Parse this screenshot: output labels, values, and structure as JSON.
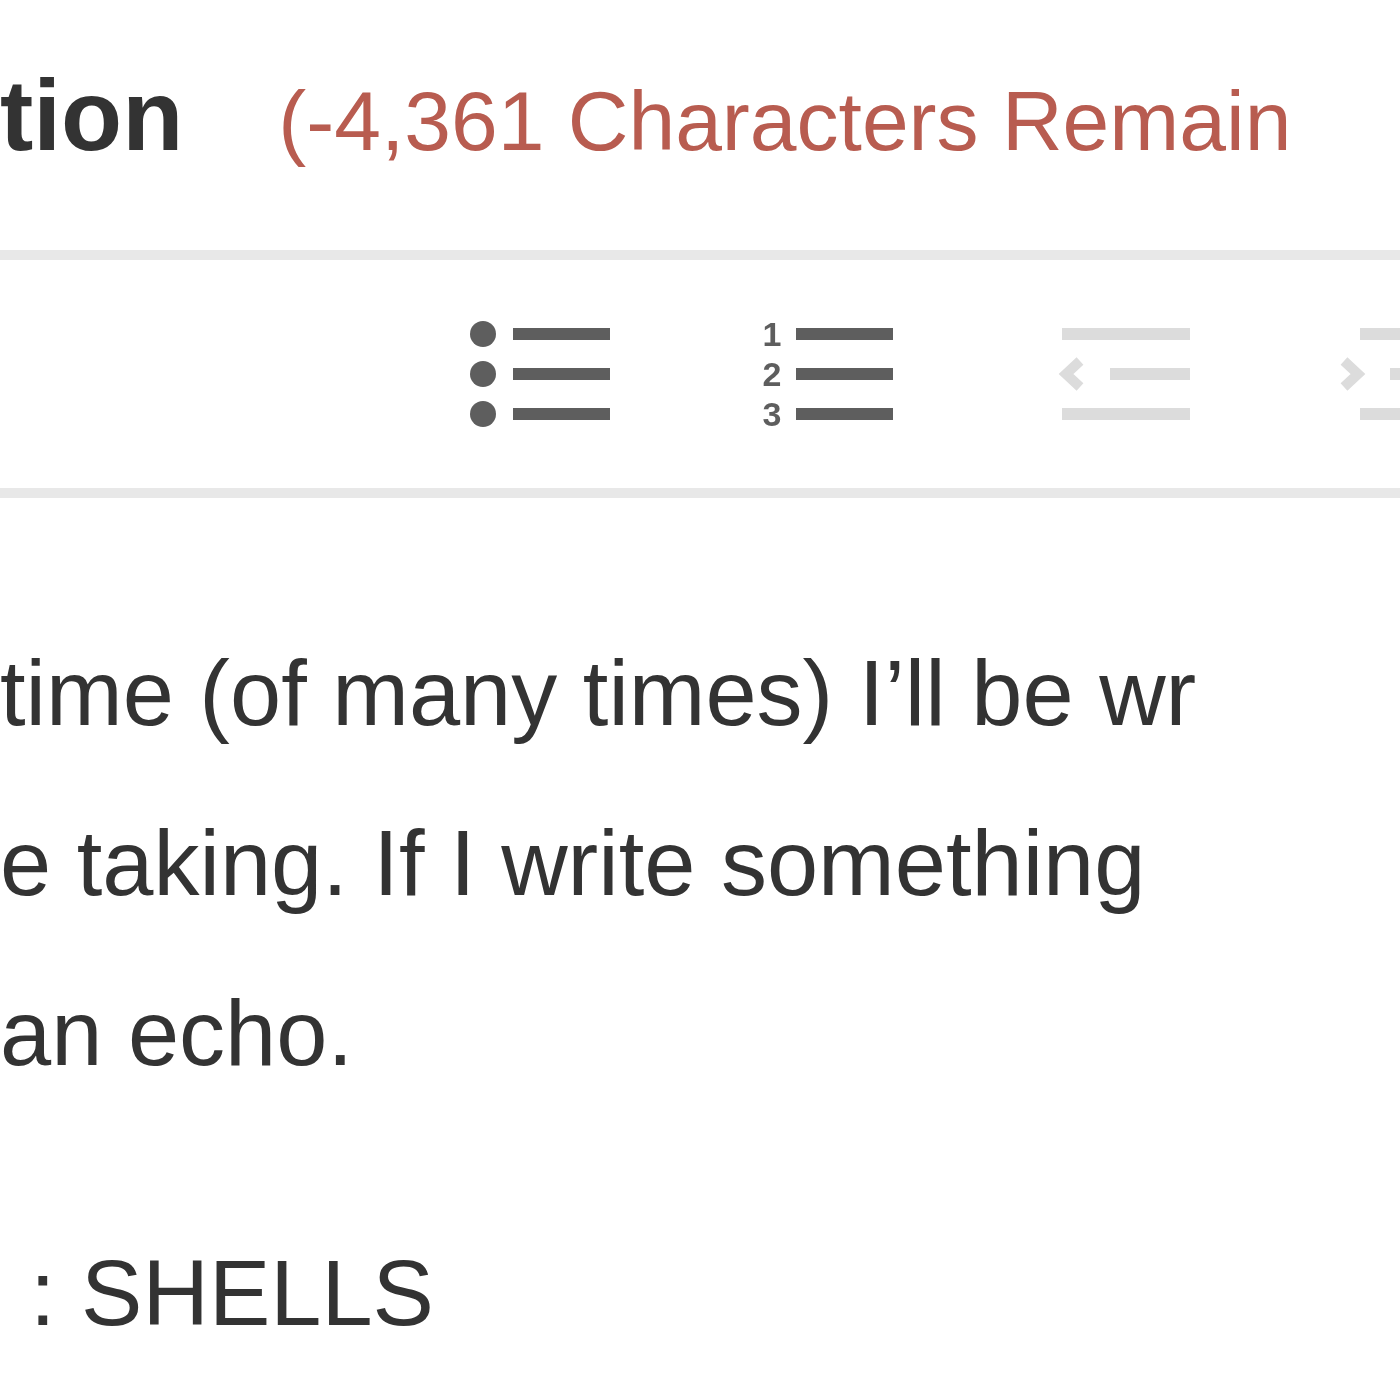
{
  "header": {
    "title": "tion",
    "counter": "(-4,361 Characters Remain",
    "over_limit": true
  },
  "toolbar": [
    {
      "kind": "bullets",
      "disabled": false
    },
    {
      "kind": "numbers",
      "disabled": false,
      "markers": [
        "1",
        "2",
        "3"
      ]
    },
    {
      "kind": "outdent",
      "disabled": true
    },
    {
      "kind": "indent",
      "disabled": true
    }
  ],
  "body": {
    "lines": [
      "time (of many times) I’ll be wr",
      "e taking. If I write something",
      "an echo."
    ],
    "heading": ": SHELLS"
  }
}
